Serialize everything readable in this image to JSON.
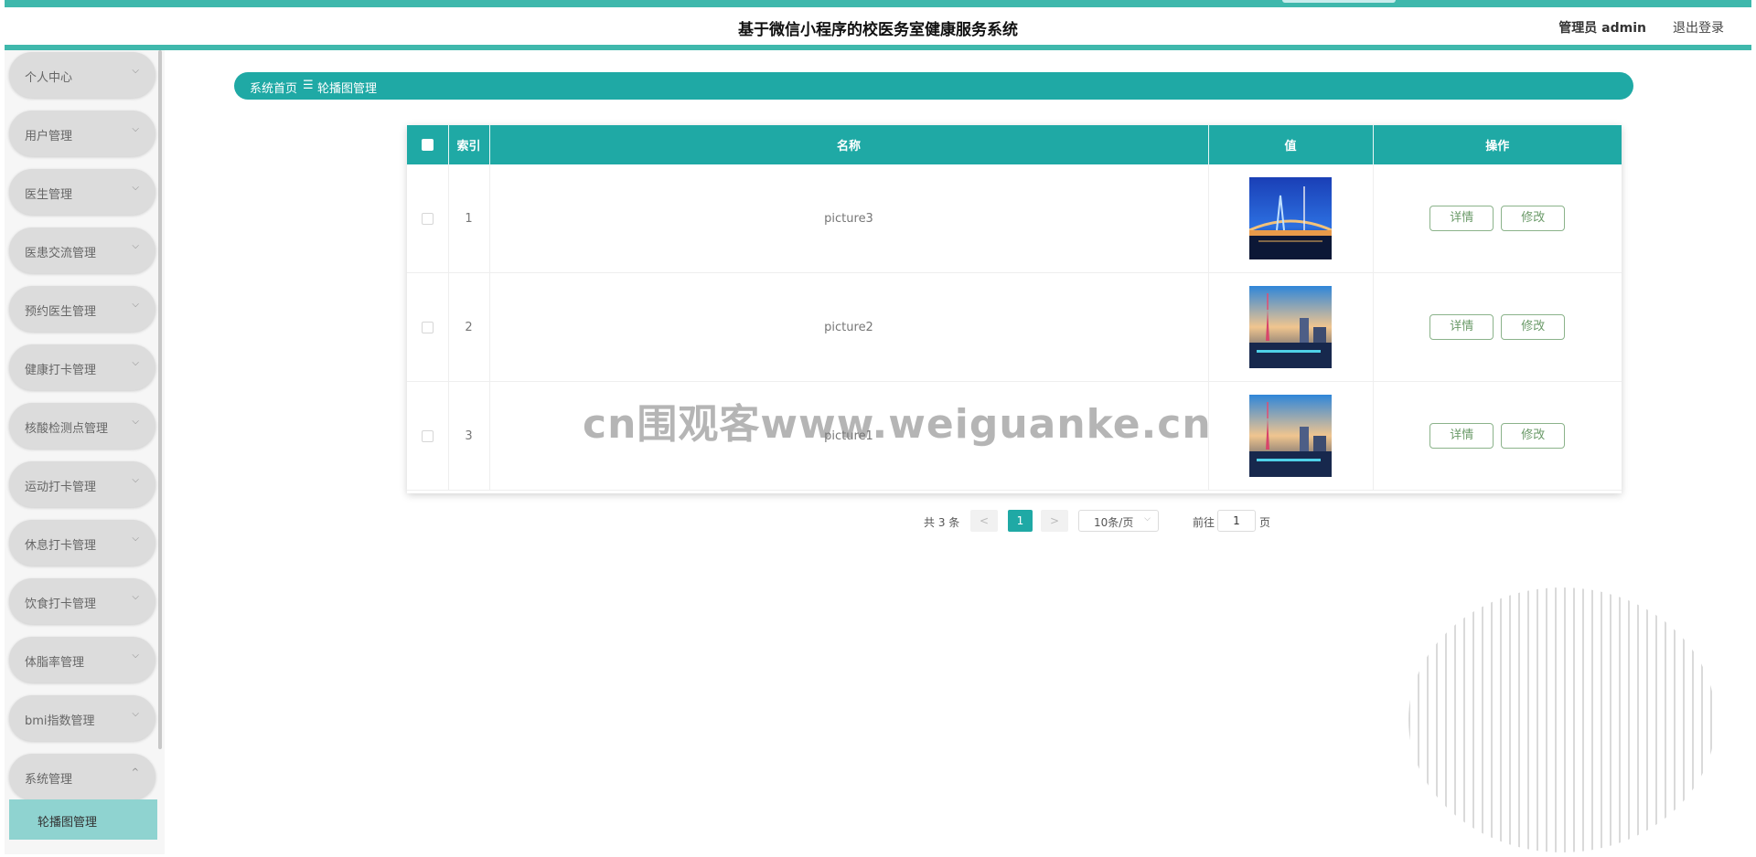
{
  "header": {
    "title": "基于微信小程序的校医务室健康服务系统",
    "user": "管理员 admin",
    "logout": "退出登录"
  },
  "sidebar": {
    "items": [
      {
        "label": "个人中心",
        "chevron": "⌵"
      },
      {
        "label": "用户管理",
        "chevron": "⌵"
      },
      {
        "label": "医生管理",
        "chevron": "⌵"
      },
      {
        "label": "医患交流管理",
        "chevron": "⌵"
      },
      {
        "label": "预约医生管理",
        "chevron": "⌵"
      },
      {
        "label": "健康打卡管理",
        "chevron": "⌵"
      },
      {
        "label": "核酸检测点管理",
        "chevron": "⌵"
      },
      {
        "label": "运动打卡管理",
        "chevron": "⌵"
      },
      {
        "label": "休息打卡管理",
        "chevron": "⌵"
      },
      {
        "label": "饮食打卡管理",
        "chevron": "⌵"
      },
      {
        "label": "体脂率管理",
        "chevron": "⌵"
      },
      {
        "label": "bmi指数管理",
        "chevron": "⌵"
      },
      {
        "label": "系统管理",
        "chevron": "^"
      }
    ],
    "sub_item": "轮播图管理"
  },
  "breadcrumb": {
    "home": "系统首页",
    "separator": "☰",
    "current": "轮播图管理"
  },
  "table": {
    "headers": {
      "index": "索引",
      "name": "名称",
      "value": "值",
      "actions": "操作"
    },
    "rows": [
      {
        "index": "1",
        "name": "picture3",
        "thumb": "bridge-night-fountain"
      },
      {
        "index": "2",
        "name": "picture2",
        "thumb": "city-tower-sunset"
      },
      {
        "index": "3",
        "name": "picture1",
        "thumb": "city-tower-sunset"
      }
    ],
    "detail_label": "详情",
    "edit_label": "修改"
  },
  "pagination": {
    "total": "共 3 条",
    "prev": "<",
    "current": "1",
    "next": ">",
    "page_size": "10条/页",
    "goto_prefix": "前往",
    "goto_value": "1",
    "goto_suffix": "页"
  },
  "watermark": "cn围观客www.weiguanke.cn",
  "colors": {
    "accent": "#1fa9a5",
    "sidebar_item": "#dcdcdc",
    "sub_active": "#8fd3d0",
    "button_border": "#8bb38a"
  }
}
